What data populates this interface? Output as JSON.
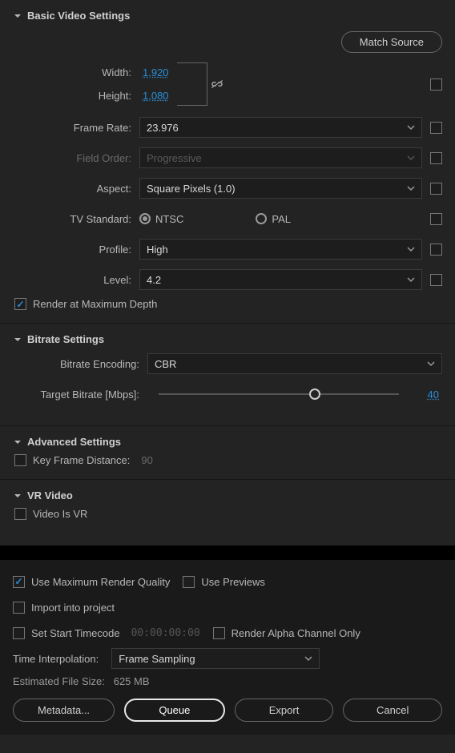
{
  "sections": {
    "basic": {
      "title": "Basic Video Settings"
    },
    "bitrate": {
      "title": "Bitrate Settings"
    },
    "advanced": {
      "title": "Advanced Settings"
    },
    "vr": {
      "title": "VR Video"
    }
  },
  "matchSource": "Match Source",
  "basic": {
    "widthLabel": "Width:",
    "widthValue": "1,920",
    "heightLabel": "Height:",
    "heightValue": "1,080",
    "frameRateLabel": "Frame Rate:",
    "frameRateValue": "23.976",
    "fieldOrderLabel": "Field Order:",
    "fieldOrderValue": "Progressive",
    "aspectLabel": "Aspect:",
    "aspectValue": "Square Pixels (1.0)",
    "tvStdLabel": "TV Standard:",
    "tvNtsc": "NTSC",
    "tvPal": "PAL",
    "profileLabel": "Profile:",
    "profileValue": "High",
    "levelLabel": "Level:",
    "levelValue": "4.2",
    "renderMaxDepth": "Render at Maximum Depth"
  },
  "bitrate": {
    "encodingLabel": "Bitrate Encoding:",
    "encodingValue": "CBR",
    "targetLabel": "Target Bitrate [Mbps]:",
    "targetValue": "40",
    "sliderPercent": 65
  },
  "advanced": {
    "keyFrameLabel": "Key Frame Distance:",
    "keyFrameValue": "90"
  },
  "vr": {
    "isVrLabel": "Video Is VR"
  },
  "footer": {
    "useMaxRender": "Use Maximum Render Quality",
    "usePreviews": "Use Previews",
    "importProject": "Import into project",
    "setStartTc": "Set Start Timecode",
    "tcValue": "00:00:00:00",
    "renderAlpha": "Render Alpha Channel Only",
    "timeInterpLabel": "Time Interpolation:",
    "timeInterpValue": "Frame Sampling",
    "estLabel": "Estimated File Size:",
    "estValue": "625 MB",
    "metadata": "Metadata...",
    "queue": "Queue",
    "export": "Export",
    "cancel": "Cancel"
  }
}
